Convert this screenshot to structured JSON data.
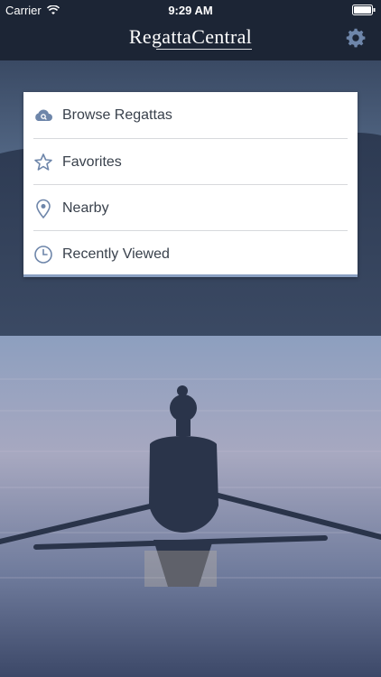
{
  "status_bar": {
    "carrier": "Carrier",
    "time": "9:29 AM"
  },
  "navbar": {
    "logo": "RegattaCentral",
    "settings_icon": "gear-icon"
  },
  "menu": {
    "items": [
      {
        "label": "Browse Regattas",
        "icon": "cloud-search-icon"
      },
      {
        "label": "Favorites",
        "icon": "star-icon"
      },
      {
        "label": "Nearby",
        "icon": "map-pin-icon"
      },
      {
        "label": "Recently Viewed",
        "icon": "clock-icon"
      }
    ]
  },
  "colors": {
    "navbar_bg": "#1c2535",
    "accent": "#6e86aa",
    "menu_text": "#39414c"
  }
}
